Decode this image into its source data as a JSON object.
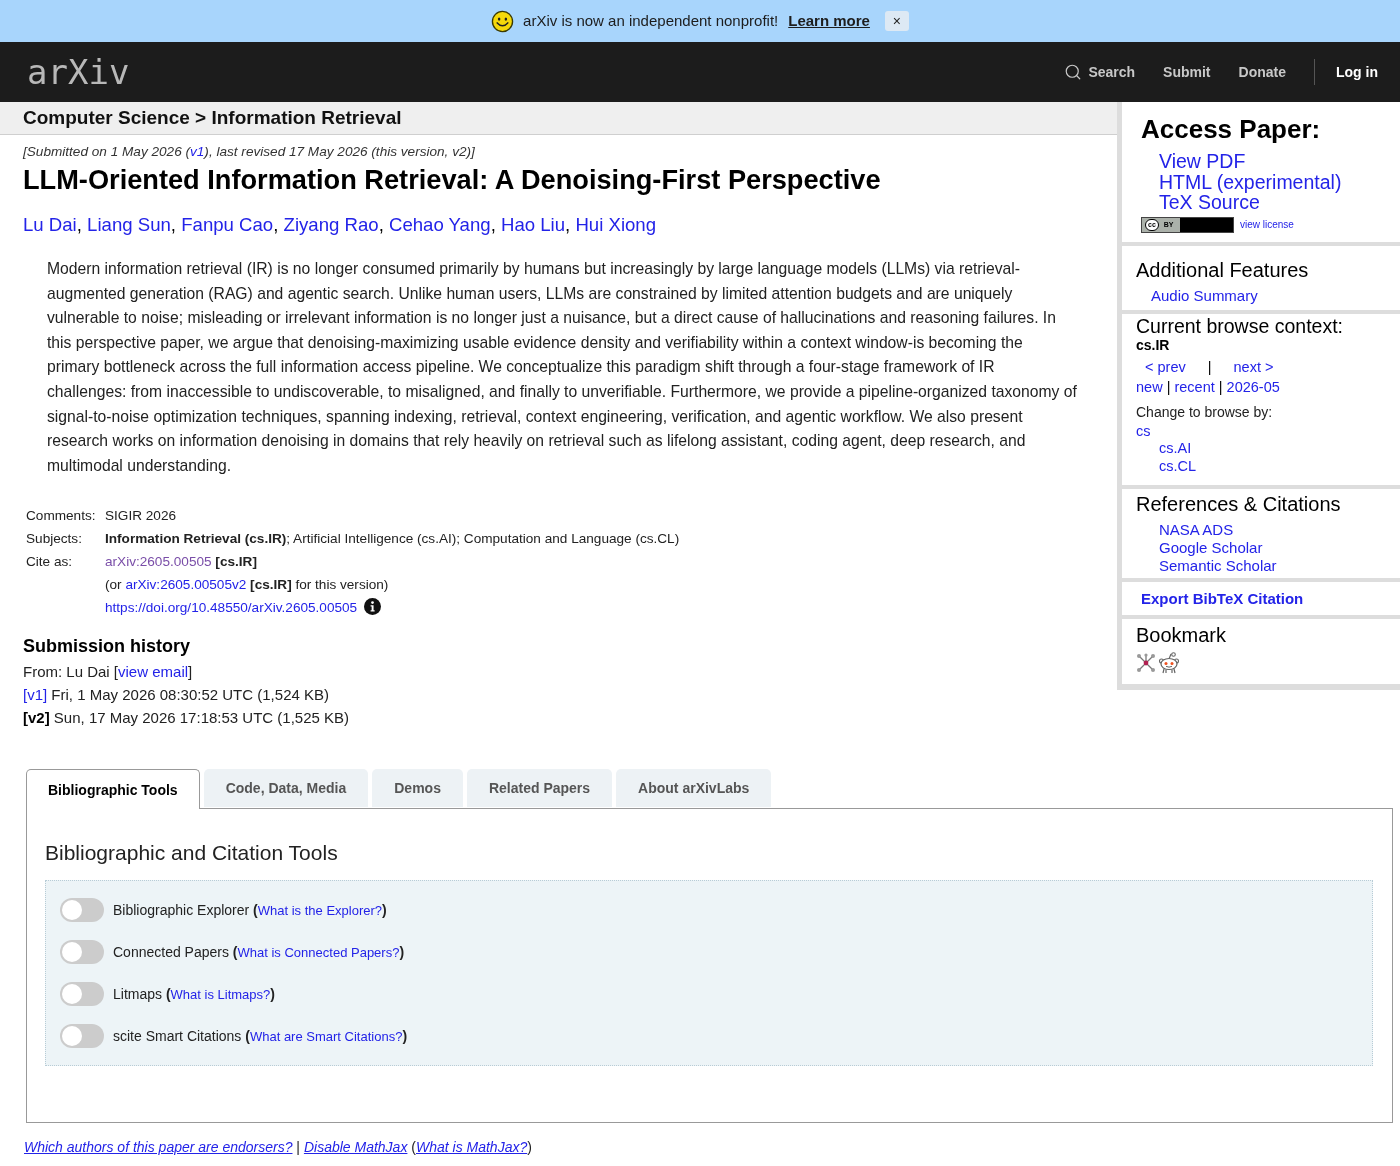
{
  "banner": {
    "message": "arXiv is now an independent nonprofit!",
    "link": "Learn more",
    "close": "×"
  },
  "header": {
    "logo": "arXiv",
    "nav": [
      {
        "kind": "search",
        "label": "Search"
      },
      {
        "kind": "link",
        "label": "Submit"
      },
      {
        "kind": "link",
        "label": "Donate"
      },
      {
        "kind": "account",
        "label": "Log in"
      }
    ]
  },
  "breadcrumb": "Computer Science > Information Retrieval",
  "paper": {
    "dateline": {
      "before": "[Submitted on 1 May 2026 (",
      "link": "v1",
      "after": "), last revised 17 May 2026 (this version, v2)]"
    },
    "title": "LLM-Oriented Information Retrieval: A Denoising-First Perspective",
    "author_separator": ", ",
    "authors": [
      "Lu Dai",
      "Liang Sun",
      "Fanpu Cao",
      "Ziyang Rao",
      "Cehao Yang",
      "Hao Liu",
      "Hui Xiong"
    ],
    "abstract": "Modern information retrieval (IR) is no longer consumed primarily by humans but increasingly by large language models (LLMs) via retrieval-augmented generation (RAG) and agentic search. Unlike human users, LLMs are constrained by limited attention budgets and are uniquely vulnerable to noise; misleading or irrelevant information is no longer just a nuisance, but a direct cause of hallucinations and reasoning failures. In this perspective paper, we argue that denoising-maximizing usable evidence density and verifiability within a context window-is becoming the primary bottleneck across the full information access pipeline. We conceptualize this paradigm shift through a four-stage framework of IR challenges: from inaccessible to undiscoverable, to misaligned, and finally to unverifiable. Furthermore, we provide a pipeline-organized taxonomy of signal-to-noise optimization techniques, spanning indexing, retrieval, context engineering, verification, and agentic workflow. We also present research works on information denoising in domains that rely heavily on retrieval such as lifelong assistant, coding agent, deep research, and multimodal understanding.",
    "metadata": [
      {
        "label": "Comments:",
        "lines": [
          {
            "text": "SIGIR 2026"
          }
        ]
      },
      {
        "label": "Subjects:",
        "lines": [
          {
            "text": "**Information Retrieval (cs.IR)**; Artificial Intelligence (cs.AI); Computation and Language (cs.CL)"
          }
        ]
      },
      {
        "label": "Cite as:",
        "lines": [
          {
            "link": "arXiv:2605.00505",
            "visited": true,
            "after": " **[cs.IR]**"
          },
          {
            "before": "(or ",
            "link": "arXiv:2605.00505v2",
            "visited": false,
            "after": " **[cs.IR]** for this version)"
          },
          {
            "link": "https://doi.org/10.48550/arXiv.2605.00505",
            "visited": false,
            "info": true
          }
        ]
      }
    ],
    "history": {
      "title": "Submission history",
      "from": {
        "before": "From: Lu Dai [",
        "link": "view email",
        "after": "]"
      },
      "versions": [
        {
          "label": "[v1]",
          "selected": false,
          "details": " Fri, 1 May 2026 08:30:52 UTC (1,524 KB)"
        },
        {
          "label": "[v2]",
          "selected": true,
          "details": " Sun, 17 May 2026 17:18:53 UTC (1,525 KB)"
        }
      ]
    }
  },
  "sidebar": {
    "access": {
      "title": "Access Paper:",
      "links": [
        "View PDF",
        "HTML (experimental)",
        "TeX Source"
      ],
      "license": {
        "symbol": "cc",
        "type": "BY",
        "link": "view license"
      }
    },
    "additional": {
      "title": "Additional Features",
      "links": [
        "Audio Summary"
      ]
    },
    "browse": {
      "title": "Current browse context:",
      "context": "cs.IR",
      "pager": [
        {
          "kind": "link",
          "text": "< prev"
        },
        {
          "kind": "sep",
          "text": "|"
        },
        {
          "kind": "link",
          "text": "next >"
        }
      ],
      "lists": [
        {
          "kind": "link",
          "text": "new"
        },
        {
          "kind": "sep",
          "text": " | "
        },
        {
          "kind": "link",
          "text": "recent"
        },
        {
          "kind": "sep",
          "text": " | "
        },
        {
          "kind": "link",
          "text": "2026-05"
        }
      ],
      "change_label": "Change to browse by:",
      "categories": [
        {
          "label": "cs",
          "children": [
            {
              "label": "cs.AI"
            },
            {
              "label": "cs.CL"
            }
          ]
        }
      ]
    },
    "references": {
      "title": "References & Citations",
      "links": [
        "NASA ADS",
        "Google Scholar",
        "Semantic Scholar"
      ]
    },
    "export": {
      "link": "Export BibTeX Citation"
    },
    "bookmark": {
      "title": "Bookmark"
    }
  },
  "labs": {
    "tabs": [
      {
        "label": "Bibliographic Tools",
        "selected": true
      },
      {
        "label": "Code, Data, Media",
        "selected": false
      },
      {
        "label": "Demos",
        "selected": false
      },
      {
        "label": "Related Papers",
        "selected": false
      },
      {
        "label": "About arXivLabs",
        "selected": false
      }
    ],
    "heading": "Bibliographic and Citation Tools",
    "brackets": [
      " (",
      ")"
    ],
    "tools": [
      {
        "name": "Bibliographic Explorer",
        "link": "What is the Explorer?",
        "on": false
      },
      {
        "name": "Connected Papers",
        "link": "What is Connected Papers?",
        "on": false
      },
      {
        "name": "Litmaps",
        "link": "What is Litmaps?",
        "on": false
      },
      {
        "name": "scite Smart Citations",
        "link": "What are Smart Citations?",
        "on": false
      }
    ]
  },
  "footer": [
    {
      "kind": "link",
      "text": "Which authors of this paper are endorsers?"
    },
    {
      "kind": "text",
      "text": " | "
    },
    {
      "kind": "link",
      "text": "Disable MathJax"
    },
    {
      "kind": "text",
      "text": " ("
    },
    {
      "kind": "link",
      "text": "What is MathJax?"
    },
    {
      "kind": "text",
      "text": ")"
    }
  ]
}
